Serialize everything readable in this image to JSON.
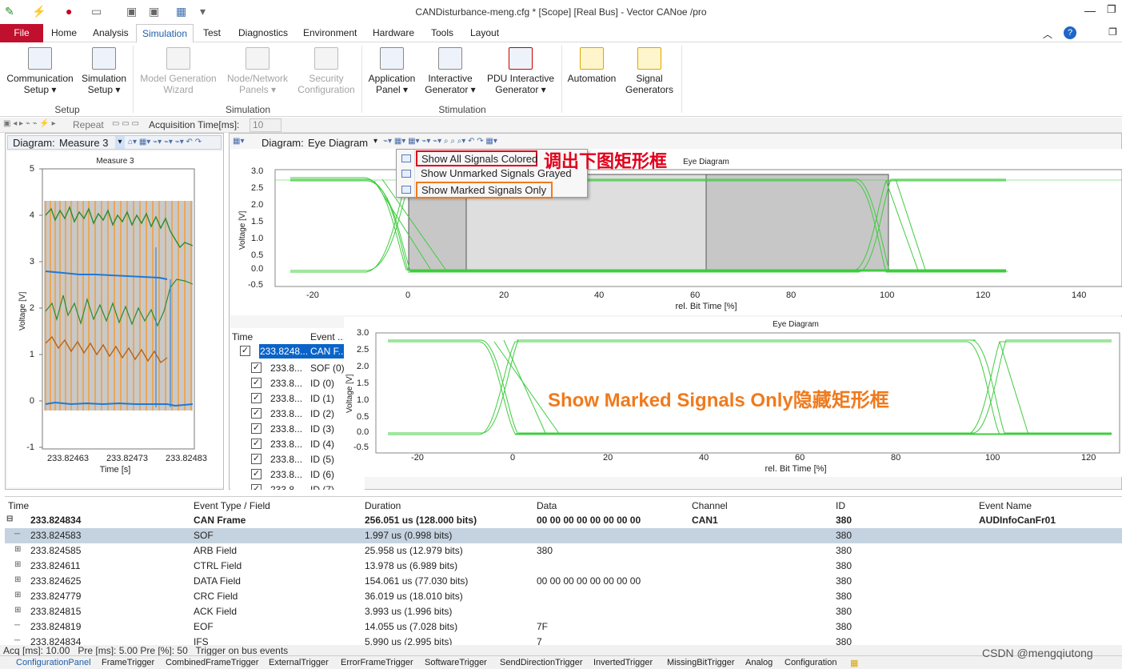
{
  "window": {
    "title": "CANDisturbance-meng.cfg * [Scope] [Real Bus] - Vector CANoe /pro"
  },
  "menu_tabs": [
    "File",
    "Home",
    "Analysis",
    "Simulation",
    "Test",
    "Diagnostics",
    "Environment",
    "Hardware",
    "Tools",
    "Layout"
  ],
  "ribbon": {
    "buttons": [
      {
        "l1": "Communication",
        "l2": "Setup ▾",
        "disabled": false
      },
      {
        "l1": "Simulation",
        "l2": "Setup ▾",
        "disabled": false
      },
      {
        "l1": "Model Generation",
        "l2": "Wizard",
        "disabled": true
      },
      {
        "l1": "Node/Network",
        "l2": "Panels ▾",
        "disabled": true
      },
      {
        "l1": "Security",
        "l2": "Configuration",
        "disabled": true
      },
      {
        "l1": "Application",
        "l2": "Panel ▾",
        "disabled": false
      },
      {
        "l1": "Interactive",
        "l2": "Generator ▾",
        "disabled": false
      },
      {
        "l1": "PDU Interactive",
        "l2": "Generator ▾",
        "disabled": false
      },
      {
        "l1": "Automation",
        "l2": "",
        "disabled": false
      },
      {
        "l1": "Signal",
        "l2": "Generators",
        "disabled": false
      }
    ],
    "groups": [
      "Setup",
      "Simulation",
      "Stimulation"
    ]
  },
  "toolbar2": {
    "repeat": "Repeat",
    "acq_label": "Acquisition Time[ms]:",
    "acq_value": "10"
  },
  "left_diagram": {
    "header_label": "Diagram:",
    "header_value": "Measure 3",
    "chart_title": "Measure 3",
    "ylabel": "Voltage [V]",
    "xlabel": "Time [s]",
    "yticks": [
      "5",
      "4",
      "3",
      "2",
      "1",
      "0",
      "-1"
    ],
    "xticks": [
      "233.82463",
      "233.82473",
      "233.82483"
    ]
  },
  "right_diagram": {
    "header_label": "Diagram:",
    "header_value": "Eye Diagram",
    "chart_title": "Eye Diagram",
    "ylabel": "Voltage [V]",
    "xlabel": "rel. Bit Time [%]",
    "yticks": [
      "3.0",
      "2.5",
      "2.0",
      "1.5",
      "1.0",
      "0.5",
      "0.0",
      "-0.5"
    ],
    "xticks": [
      "-20",
      "0",
      "20",
      "40",
      "60",
      "80",
      "100",
      "120",
      "140"
    ]
  },
  "lower_diagram": {
    "chart_title": "Eye Diagram",
    "ylabel": "Voltage [V]",
    "xlabel": "rel. Bit Time [%]",
    "yticks": [
      "3.0",
      "2.5",
      "2.0",
      "1.5",
      "1.0",
      "0.5",
      "0.0",
      "-0.5"
    ],
    "xticks": [
      "-20",
      "0",
      "20",
      "40",
      "60",
      "80",
      "100",
      "120"
    ]
  },
  "context_menu": [
    "Show All Signals Colored",
    "Show Unmarked Signals Grayed",
    "Show Marked Signals Only"
  ],
  "annotations": {
    "top": "调出下图矩形框",
    "bottom": "Show Marked Signals Only隐藏矩形框"
  },
  "tree": {
    "headers": [
      "Time",
      "Event ..."
    ],
    "root": {
      "time": "233.8248...",
      "event": "CAN F..."
    },
    "rows": [
      {
        "time": "233.8...",
        "event": "SOF (0)"
      },
      {
        "time": "233.8...",
        "event": "ID (0)"
      },
      {
        "time": "233.8...",
        "event": "ID (1)"
      },
      {
        "time": "233.8...",
        "event": "ID (2)"
      },
      {
        "time": "233.8...",
        "event": "ID (3)"
      },
      {
        "time": "233.8...",
        "event": "ID (4)"
      },
      {
        "time": "233.8...",
        "event": "ID (5)"
      },
      {
        "time": "233.8...",
        "event": "ID (6)"
      },
      {
        "time": "233.8",
        "event": "ID (7)"
      }
    ]
  },
  "grid": {
    "headers": [
      "Time",
      "Event Type / Field",
      "Duration",
      "Data",
      "Channel",
      "ID",
      "Event Name"
    ],
    "rows": [
      {
        "time": "233.824834",
        "type": "CAN Frame",
        "dur": "256.051 us (128.000 bits)",
        "data": "00 00 00 00 00 00 00 00",
        "ch": "CAN1",
        "id": "380",
        "name": "AUDInfoCanFr01",
        "bold": true
      },
      {
        "time": "233.824583",
        "type": "SOF",
        "dur": "1.997 us (0.998 bits)",
        "data": "",
        "ch": "",
        "id": "380",
        "name": "",
        "sel": true
      },
      {
        "time": "233.824585",
        "type": "ARB Field",
        "dur": "25.958 us (12.979 bits)",
        "data": "380",
        "ch": "",
        "id": "380",
        "name": ""
      },
      {
        "time": "233.824611",
        "type": "CTRL Field",
        "dur": "13.978 us (6.989 bits)",
        "data": "",
        "ch": "",
        "id": "380",
        "name": ""
      },
      {
        "time": "233.824625",
        "type": "DATA Field",
        "dur": "154.061 us (77.030 bits)",
        "data": "00 00 00 00 00 00 00 00",
        "ch": "",
        "id": "380",
        "name": ""
      },
      {
        "time": "233.824779",
        "type": "CRC Field",
        "dur": "36.019 us (18.010 bits)",
        "data": "",
        "ch": "",
        "id": "380",
        "name": ""
      },
      {
        "time": "233.824815",
        "type": "ACK Field",
        "dur": "3.993 us (1.996 bits)",
        "data": "",
        "ch": "",
        "id": "380",
        "name": ""
      },
      {
        "time": "233.824819",
        "type": "EOF",
        "dur": "14.055 us (7.028 bits)",
        "data": "7F",
        "ch": "",
        "id": "380",
        "name": ""
      },
      {
        "time": "233.824834",
        "type": "IFS",
        "dur": "5.990 us (2.995 bits)",
        "data": "7",
        "ch": "",
        "id": "380",
        "name": ""
      }
    ]
  },
  "status": {
    "text": "Acq [ms]: 10.00   Pre [ms]: 5.00 Pre [%]: 50   Trigger on bus events",
    "watermark": "CSDN @mengqiutong"
  },
  "bottom_tabs": [
    "ConfigurationPanel",
    "FrameTrigger",
    "CombinedFrameTrigger",
    "ExternalTrigger",
    "ErrorFrameTrigger",
    "SoftwareTrigger",
    "SendDirectionTrigger",
    "InvertedTrigger",
    "MissingBitTrigger",
    "Analog",
    "Configuration"
  ]
}
